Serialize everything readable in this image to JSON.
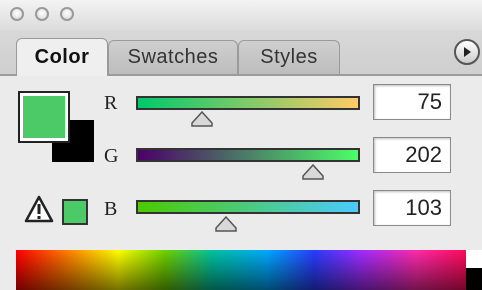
{
  "tabs": {
    "color": "Color",
    "swatches": "Swatches",
    "styles": "Styles"
  },
  "channels": [
    {
      "label": "R",
      "value": "75",
      "fraction": 0.294
    },
    {
      "label": "G",
      "value": "202",
      "fraction": 0.792
    },
    {
      "label": "B",
      "value": "103",
      "fraction": 0.404
    }
  ],
  "colors": {
    "foreground": "#4bca67",
    "background": "#000000",
    "gamut_swatch": "#4bca67"
  },
  "icons": {
    "window_controls": "traffic-light-circles",
    "panel_menu": "right-arrow-menu",
    "gamut_warning": "warning-triangle"
  }
}
